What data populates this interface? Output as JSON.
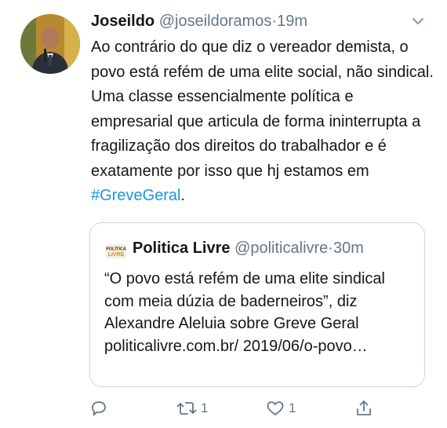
{
  "tweet": {
    "author_name": "Joseildo",
    "author_handle": "@joseildoramos",
    "separator": "·",
    "time": "19m",
    "text_before": "Ao contrário do que diz o vereador demista, o povo está refém de uma elite social, não sindical. Uma classe essencialmente política e empresarial que articula de forma ininterrupta a fragilização dos direitos do trabalhador e é exatamente por isso que hj estamos em ",
    "hashtag": "#GreveGeral",
    "text_after": ".",
    "link_color": "#1b95e0"
  },
  "quoted_tweet": {
    "logo_text_top": "POLÍTICA",
    "logo_text_bottom": "LIVRE",
    "author_name": "Politica Livre",
    "author_handle": "@politicalivre",
    "separator": "·",
    "time": "30m",
    "text": "“O povo está refém de uma elite sindical com meia dúzia de baderneiros”, diz Alexandre Aleluia sobre Greve Geral politicalivre.com.br/ 2019/06/o-povo…"
  },
  "actions": {
    "reply_icon": "reply-icon",
    "retweet_icon": "retweet-icon",
    "retweet_count": "1",
    "like_icon": "heart-icon",
    "like_count": "1",
    "share_icon": "share-icon"
  }
}
